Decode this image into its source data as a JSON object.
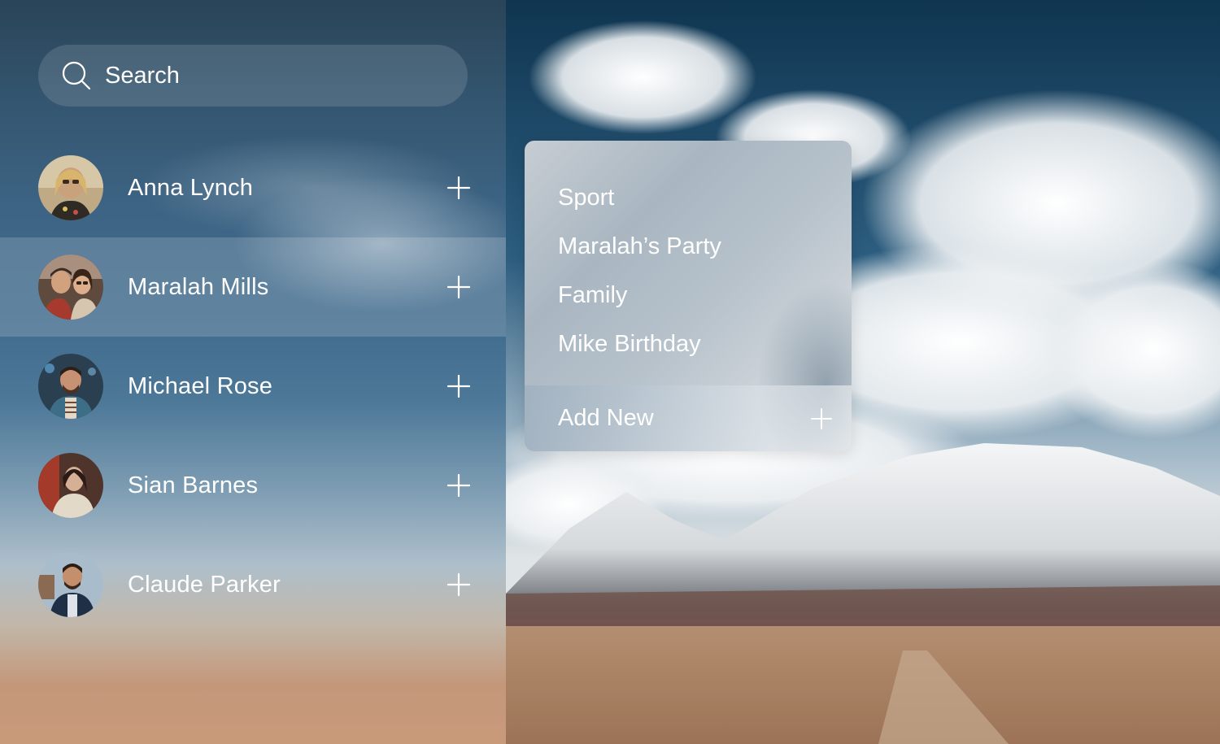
{
  "search": {
    "placeholder": "Search",
    "icon": "search-icon"
  },
  "contacts": [
    {
      "name": "Anna Lynch",
      "avatar_bg": "#b9a07d",
      "selected": false
    },
    {
      "name": "Maralah Mills",
      "avatar_bg": "#6d4b3b",
      "selected": true
    },
    {
      "name": "Michael Rose",
      "avatar_bg": "#2e4659",
      "selected": false
    },
    {
      "name": "Sian Barnes",
      "avatar_bg": "#5a3a2c",
      "selected": false
    },
    {
      "name": "Claude Parker",
      "avatar_bg": "#9fb4c2",
      "selected": false
    }
  ],
  "add_icon": "plus-icon",
  "menu": {
    "items": [
      "Sport",
      "Maralah’s Party",
      "Family",
      "Mike Birthday"
    ],
    "add_new_label": "Add New"
  },
  "colors": {
    "text": "#ffffff",
    "panel_top": "#2a4458",
    "panel_bottom": "#c99a7a"
  }
}
